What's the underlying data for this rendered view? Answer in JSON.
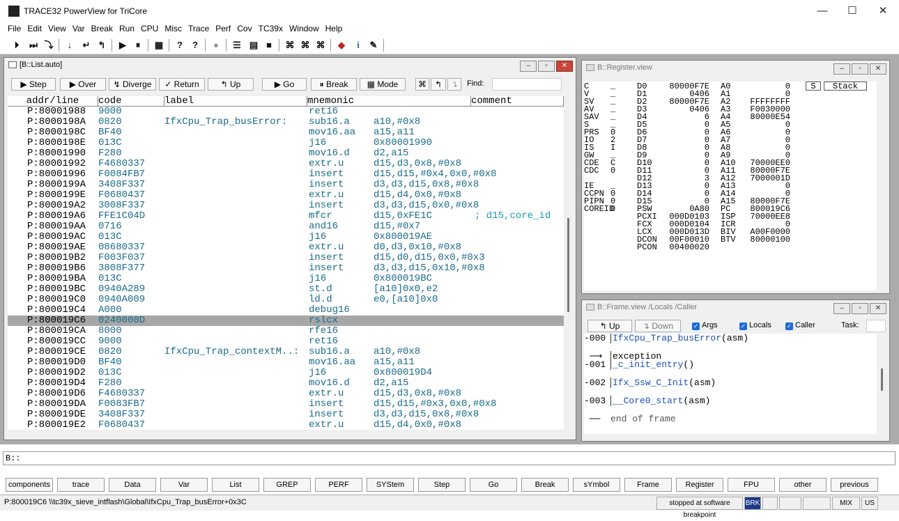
{
  "app": {
    "title": "TRACE32 PowerView for TriCore"
  },
  "menu": [
    "File",
    "Edit",
    "View",
    "Var",
    "Break",
    "Run",
    "CPU",
    "Misc",
    "Trace",
    "Perf",
    "Cov",
    "TC39x",
    "Window",
    "Help"
  ],
  "toolbar": {
    "icons": [
      "step-into-icon",
      "step-over-icon",
      "diverge-icon",
      "step-down-icon",
      "return-icon",
      "up-icon",
      "go-icon",
      "break-icon",
      "mode-icon",
      "help-icon",
      "help-context-icon",
      "stop-icon",
      "list-icon",
      "register-icon",
      "memory-icon",
      "frame-icon",
      "var-icon",
      "watch-icon",
      "chip-icon",
      "info-icon",
      "tools-icon"
    ]
  },
  "list_window": {
    "title": "[B::List.auto]",
    "buttons": {
      "step": "Step",
      "over": "Over",
      "diverge": "Diverge",
      "return": "Return",
      "up": "Up",
      "go": "Go",
      "break": "Break",
      "mode": "Mode",
      "find": "Find:"
    },
    "columns": {
      "addr": "addr/line",
      "code": "code",
      "label": "label",
      "mnemonic": "mnemonic",
      "comment": "comment"
    },
    "rows": [
      {
        "addr": "P:80001988",
        "code": "9000",
        "label": "",
        "mn": "ret16",
        "op": "",
        "cm": ""
      },
      {
        "addr": "P:8000198A",
        "code": "0820",
        "label": "IfxCpu_Trap_busError:",
        "mn": "sub16.a",
        "op": "a10,#0x8",
        "cm": ""
      },
      {
        "addr": "P:8000198C",
        "code": "BF40",
        "label": "",
        "mn": "mov16.aa",
        "op": "a15,a11",
        "cm": ""
      },
      {
        "addr": "P:8000198E",
        "code": "013C",
        "label": "",
        "mn": "j16",
        "op": "0x80001990",
        "cm": ""
      },
      {
        "addr": "P:80001990",
        "code": "F280",
        "label": "",
        "mn": "mov16.d",
        "op": "d2,a15",
        "cm": ""
      },
      {
        "addr": "P:80001992",
        "code": "F4680337",
        "label": "",
        "mn": "extr.u",
        "op": "d15,d3,0x8,#0x8",
        "cm": ""
      },
      {
        "addr": "P:80001996",
        "code": "F0084FB7",
        "label": "",
        "mn": "insert",
        "op": "d15,d15,#0x4,0x0,#0x8",
        "cm": ""
      },
      {
        "addr": "P:8000199A",
        "code": "3408F337",
        "label": "",
        "mn": "insert",
        "op": "d3,d3,d15,0x8,#0x8",
        "cm": ""
      },
      {
        "addr": "P:8000199E",
        "code": "F0680437",
        "label": "",
        "mn": "extr.u",
        "op": "d15,d4,0x0,#0x8",
        "cm": ""
      },
      {
        "addr": "P:800019A2",
        "code": "3008F337",
        "label": "",
        "mn": "insert",
        "op": "d3,d3,d15,0x0,#0x8",
        "cm": ""
      },
      {
        "addr": "P:800019A6",
        "code": "FFE1C04D",
        "label": "",
        "mn": "mfcr",
        "op": "d15,0xFE1C",
        "cm": "; d15,core_id"
      },
      {
        "addr": "P:800019AA",
        "code": "0716",
        "label": "",
        "mn": "and16",
        "op": "d15,#0x7",
        "cm": ""
      },
      {
        "addr": "P:800019AC",
        "code": "013C",
        "label": "",
        "mn": "j16",
        "op": "0x800019AE",
        "cm": ""
      },
      {
        "addr": "P:800019AE",
        "code": "08680337",
        "label": "",
        "mn": "extr.u",
        "op": "d0,d3,0x10,#0x8",
        "cm": ""
      },
      {
        "addr": "P:800019B2",
        "code": "F003F037",
        "label": "",
        "mn": "insert",
        "op": "d15,d0,d15,0x0,#0x3",
        "cm": ""
      },
      {
        "addr": "P:800019B6",
        "code": "3808F377",
        "label": "",
        "mn": "insert",
        "op": "d3,d3,d15,0x10,#0x8",
        "cm": ""
      },
      {
        "addr": "P:800019BA",
        "code": "013C",
        "label": "",
        "mn": "j16",
        "op": "0x800019BC",
        "cm": ""
      },
      {
        "addr": "P:800019BC",
        "code": "0940A289",
        "label": "",
        "mn": "st.d",
        "op": "[a10]0x0,e2",
        "cm": ""
      },
      {
        "addr": "P:800019C0",
        "code": "0940A009",
        "label": "",
        "mn": "ld.d",
        "op": "e0,[a10]0x0",
        "cm": ""
      },
      {
        "addr": "P:800019C4",
        "code": "A000",
        "label": "",
        "mn": "debug16",
        "op": "",
        "cm": ""
      },
      {
        "addr": "P:800019C6",
        "code": "0240000D",
        "label": "",
        "mn": "rslcx",
        "op": "",
        "cm": ""
      },
      {
        "addr": "P:800019CA",
        "code": "8000",
        "label": "",
        "mn": "rfe16",
        "op": "",
        "cm": ""
      },
      {
        "addr": "P:800019CC",
        "code": "9000",
        "label": "",
        "mn": "ret16",
        "op": "",
        "cm": ""
      },
      {
        "addr": "P:800019CE",
        "code": "0820",
        "label": "IfxCpu_Trap_contextM..:",
        "mn": "sub16.a",
        "op": "a10,#0x8",
        "cm": ""
      },
      {
        "addr": "P:800019D0",
        "code": "BF40",
        "label": "",
        "mn": "mov16.aa",
        "op": "a15,a11",
        "cm": ""
      },
      {
        "addr": "P:800019D2",
        "code": "013C",
        "label": "",
        "mn": "j16",
        "op": "0x800019D4",
        "cm": ""
      },
      {
        "addr": "P:800019D4",
        "code": "F280",
        "label": "",
        "mn": "mov16.d",
        "op": "d2,a15",
        "cm": ""
      },
      {
        "addr": "P:800019D6",
        "code": "F4680337",
        "label": "",
        "mn": "extr.u",
        "op": "d15,d3,0x8,#0x8",
        "cm": ""
      },
      {
        "addr": "P:800019DA",
        "code": "F0083FB7",
        "label": "",
        "mn": "insert",
        "op": "d15,d15,#0x3,0x0,#0x8",
        "cm": ""
      },
      {
        "addr": "P:800019DE",
        "code": "3408F337",
        "label": "",
        "mn": "insert",
        "op": "d3,d3,d15,0x8,#0x8",
        "cm": ""
      },
      {
        "addr": "P:800019E2",
        "code": "F0680437",
        "label": "",
        "mn": "extr.u",
        "op": "d15,d4,0x0,#0x8",
        "cm": ""
      }
    ],
    "highlight_index": 20
  },
  "register_window": {
    "title": "B::Register.view",
    "stack_btns": [
      "S",
      "Stack"
    ],
    "flags": [
      {
        "n": "C",
        "v": "_"
      },
      {
        "n": "V",
        "v": "_"
      },
      {
        "n": "SV",
        "v": "_"
      },
      {
        "n": "AV",
        "v": "_"
      },
      {
        "n": "SAV",
        "v": "_"
      },
      {
        "n": "S",
        "v": "_"
      },
      {
        "n": "PRS",
        "v": "0"
      },
      {
        "n": "IO",
        "v": "2"
      },
      {
        "n": "IS",
        "v": "I"
      },
      {
        "n": "GW",
        "v": "_"
      },
      {
        "n": "CDE",
        "v": "C"
      },
      {
        "n": "CDC",
        "v": "0"
      },
      {
        "n": "",
        "v": ""
      },
      {
        "n": "IE",
        "v": "_"
      },
      {
        "n": "CCPN",
        "v": "0"
      },
      {
        "n": "PIPN",
        "v": "0"
      },
      {
        "n": "COREID",
        "v": "0"
      }
    ],
    "regs": [
      [
        "D0",
        "80000F7E",
        "A0",
        "0"
      ],
      [
        "D1",
        "0406",
        "A1",
        "0"
      ],
      [
        "D2",
        "80000F7E",
        "A2",
        "FFFFFFFF"
      ],
      [
        "D3",
        "0406",
        "A3",
        "F0030000"
      ],
      [
        "D4",
        "6",
        "A4",
        "80000E54"
      ],
      [
        "D5",
        "0",
        "A5",
        "0"
      ],
      [
        "D6",
        "0",
        "A6",
        "0"
      ],
      [
        "D7",
        "0",
        "A7",
        "0"
      ],
      [
        "D8",
        "0",
        "A8",
        "0"
      ],
      [
        "D9",
        "0",
        "A9",
        "0"
      ],
      [
        "D10",
        "0",
        "A10",
        "70000EE0"
      ],
      [
        "D11",
        "0",
        "A11",
        "80000F7E"
      ],
      [
        "D12",
        "3",
        "A12",
        "7000001D"
      ],
      [
        "D13",
        "0",
        "A13",
        "0"
      ],
      [
        "D14",
        "0",
        "A14",
        "0"
      ],
      [
        "D15",
        "0",
        "A15",
        "80000F7E"
      ],
      [
        "PSW",
        "0A80",
        "PC",
        "800019C6"
      ],
      [
        "PCXI",
        "000D0103",
        "ISP",
        "70000EE8"
      ],
      [
        "FCX",
        "000D0104",
        "ICR",
        "0"
      ],
      [
        "LCX",
        "000D013D",
        "BIV",
        "A00F0000"
      ],
      [
        "DCON",
        "00F00010",
        "BTV",
        "80000100"
      ],
      [
        "PCON",
        "00400020",
        "",
        ""
      ]
    ]
  },
  "frame_window": {
    "title": "B::Frame.view /Locals /Caller",
    "buttons": {
      "up": "Up",
      "down": "Down",
      "args": "Args",
      "locals": "Locals",
      "caller": "Caller",
      "task": "Task:"
    },
    "rows": [
      {
        "idx": "-000",
        "fn": "IfxCpu_Trap_busError",
        "suffix": "(asm)"
      },
      {
        "idx": "",
        "fn": "exception",
        "suffix": ""
      },
      {
        "idx": "-001",
        "fn": "_c_init_entry",
        "suffix": "()"
      },
      {
        "idx": "-002",
        "fn": "Ifx_Ssw_C_Init",
        "suffix": "(asm)"
      },
      {
        "idx": "-003",
        "fn": "__Core0_start",
        "suffix": "(asm)"
      },
      {
        "idx": "",
        "fn": "end of frame",
        "suffix": ""
      }
    ]
  },
  "command": {
    "prompt": "B::"
  },
  "softkeys": [
    "components",
    "trace",
    "Data",
    "Var",
    "List",
    "GREP",
    "PERF",
    "SYStem",
    "Step",
    "Go",
    "Break",
    "sYmbol",
    "Frame",
    "Register",
    "FPU",
    "other",
    "previous"
  ],
  "status": {
    "location": "P:800019C6 \\\\tc39x_sieve_intflash\\Global\\IfxCpu_Trap_busError+0x3C",
    "state": "stopped at software breakpoint",
    "brk": "BRK",
    "mix": "MIX",
    "us": "US"
  }
}
